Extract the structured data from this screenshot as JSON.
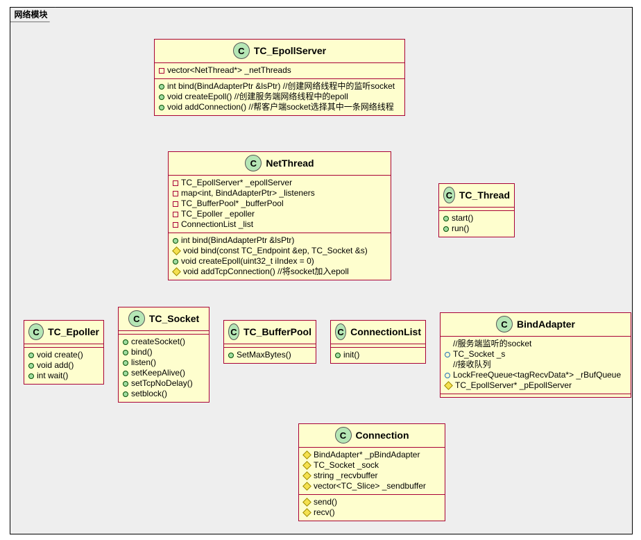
{
  "package": {
    "title": "网络模块"
  },
  "classes": {
    "TC_EpollServer": {
      "name": "TC_EpollServer",
      "fields": [
        {
          "vis": "private",
          "text": "vector<NetThread*> _netThreads"
        }
      ],
      "methods": [
        {
          "vis": "public",
          "text": "int bind(BindAdapterPtr &lsPtr) //创建网络线程中的监听socket"
        },
        {
          "vis": "public",
          "text": "void createEpoll() //创建服务端网络线程中的epoll"
        },
        {
          "vis": "public",
          "text": "void addConnection() //帮客户端socket选择其中一条网络线程"
        }
      ]
    },
    "NetThread": {
      "name": "NetThread",
      "fields": [
        {
          "vis": "private",
          "text": "TC_EpollServer* _epollServer"
        },
        {
          "vis": "private",
          "text": "map<int, BindAdapterPtr> _listeners"
        },
        {
          "vis": "private",
          "text": "TC_BufferPool* _bufferPool"
        },
        {
          "vis": "private",
          "text": "TC_Epoller _epoller"
        },
        {
          "vis": "private",
          "text": "ConnectionList _list"
        }
      ],
      "methods": [
        {
          "vis": "public",
          "text": "int bind(BindAdapterPtr &lsPtr)"
        },
        {
          "vis": "protected",
          "text": "void bind(const TC_Endpoint &ep, TC_Socket &s)"
        },
        {
          "vis": "public",
          "text": "void createEpoll(uint32_t iIndex = 0)"
        },
        {
          "vis": "protected",
          "text": "void addTcpConnection() //将socket加入epoll"
        }
      ]
    },
    "TC_Thread": {
      "name": "TC_Thread",
      "methods": [
        {
          "vis": "public",
          "text": "start()"
        },
        {
          "vis": "public",
          "text": "run()"
        }
      ]
    },
    "TC_Epoller": {
      "name": "TC_Epoller",
      "methods": [
        {
          "vis": "public",
          "text": "void create()"
        },
        {
          "vis": "public",
          "text": "void add()"
        },
        {
          "vis": "public",
          "text": "int wait()"
        }
      ]
    },
    "TC_Socket": {
      "name": "TC_Socket",
      "methods": [
        {
          "vis": "public",
          "text": "createSocket()"
        },
        {
          "vis": "public",
          "text": "bind()"
        },
        {
          "vis": "public",
          "text": "listen()"
        },
        {
          "vis": "public",
          "text": "setKeepAlive()"
        },
        {
          "vis": "public",
          "text": "setTcpNoDelay()"
        },
        {
          "vis": "public",
          "text": "setblock()"
        }
      ]
    },
    "TC_BufferPool": {
      "name": "TC_BufferPool",
      "methods": [
        {
          "vis": "public",
          "text": "SetMaxBytes()"
        }
      ]
    },
    "ConnectionList": {
      "name": "ConnectionList",
      "methods": [
        {
          "vis": "public",
          "text": "init()"
        }
      ]
    },
    "BindAdapter": {
      "name": "BindAdapter",
      "fields": [
        {
          "vis": "comment",
          "text": "//服务端监听的socket"
        },
        {
          "vis": "package",
          "text": "TC_Socket _s"
        },
        {
          "vis": "comment",
          "text": "//接收队列"
        },
        {
          "vis": "package",
          "text": "LockFreeQueue<tagRecvData*> _rBufQueue"
        },
        {
          "vis": "protected",
          "text": "TC_EpollServer* _pEpollServer"
        }
      ]
    },
    "Connection": {
      "name": "Connection",
      "fields": [
        {
          "vis": "protected",
          "text": "BindAdapter* _pBindAdapter"
        },
        {
          "vis": "protected",
          "text": "TC_Socket _sock"
        },
        {
          "vis": "protected",
          "text": "string _recvbuffer"
        },
        {
          "vis": "protected",
          "text": "vector<TC_Slice> _sendbuffer"
        }
      ],
      "methods": [
        {
          "vis": "protected",
          "text": "send()"
        },
        {
          "vis": "protected",
          "text": "recv()"
        }
      ]
    }
  },
  "relations": [
    {
      "from": "TC_EpollServer",
      "to": "NetThread",
      "type": "aggregation"
    },
    {
      "from": "NetThread",
      "to": "TC_Thread",
      "type": "inheritance"
    },
    {
      "from": "NetThread",
      "to": "ConnectionList",
      "type": "aggregation"
    },
    {
      "from": "NetThread",
      "to": "TC_Epoller",
      "type": "association-arrow"
    },
    {
      "from": "NetThread",
      "to": "TC_Socket",
      "type": "association-arrow"
    },
    {
      "from": "NetThread",
      "to": "TC_BufferPool",
      "type": "association-arrow"
    },
    {
      "from": "NetThread",
      "to": "BindAdapter",
      "type": "association-arrow"
    },
    {
      "from": "ConnectionList",
      "to": "Connection",
      "type": "composition"
    }
  ]
}
